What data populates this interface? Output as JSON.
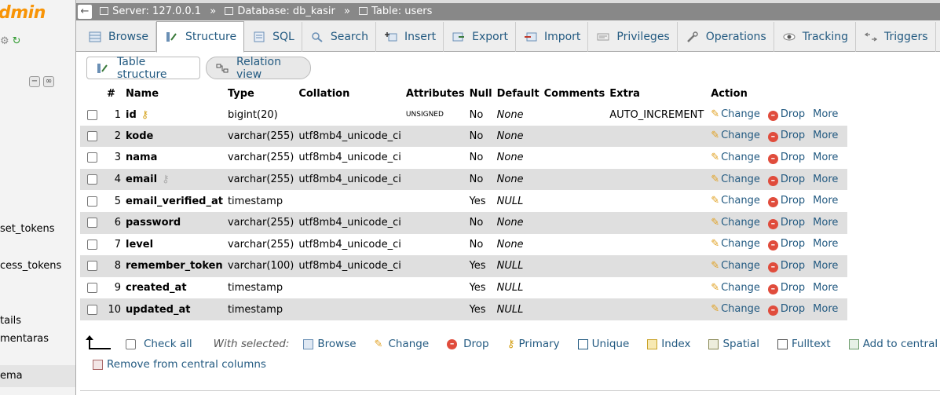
{
  "left_nav": {
    "brand": "dmin",
    "items": [
      {
        "label": "set_tokens",
        "highlight": false
      },
      {
        "label": "cess_tokens",
        "highlight": false
      },
      {
        "label": "tails",
        "highlight": false
      },
      {
        "label": "mentaras",
        "highlight": false
      },
      {
        "label": "ema",
        "highlight": true
      }
    ]
  },
  "breadcrumb": {
    "server": "Server: 127.0.0.1",
    "database": "Database: db_kasir",
    "table": "Table: users",
    "separator": "»"
  },
  "tabs": [
    {
      "label": "Browse",
      "icon": "browse-icon",
      "active": false
    },
    {
      "label": "Structure",
      "icon": "structure-icon",
      "active": true
    },
    {
      "label": "SQL",
      "icon": "sql-icon",
      "active": false
    },
    {
      "label": "Search",
      "icon": "search-icon",
      "active": false
    },
    {
      "label": "Insert",
      "icon": "insert-icon",
      "active": false
    },
    {
      "label": "Export",
      "icon": "export-icon",
      "active": false
    },
    {
      "label": "Import",
      "icon": "import-icon",
      "active": false
    },
    {
      "label": "Privileges",
      "icon": "privileges-icon",
      "active": false
    },
    {
      "label": "Operations",
      "icon": "wrench-icon",
      "active": false
    },
    {
      "label": "Tracking",
      "icon": "eye-icon",
      "active": false
    },
    {
      "label": "Triggers",
      "icon": "triggers-icon",
      "active": false
    }
  ],
  "subtabs": {
    "table_structure": "Table structure",
    "relation_view": "Relation view"
  },
  "columns": [
    "#",
    "Name",
    "Type",
    "Collation",
    "Attributes",
    "Null",
    "Default",
    "Comments",
    "Extra",
    "Action"
  ],
  "rows": [
    {
      "num": "1",
      "name": "id",
      "key": "primary",
      "type": "bigint(20)",
      "collation": "",
      "attributes": "UNSIGNED",
      "null": "No",
      "default": "None",
      "comments": "",
      "extra": "AUTO_INCREMENT"
    },
    {
      "num": "2",
      "name": "kode",
      "key": "",
      "type": "varchar(255)",
      "collation": "utf8mb4_unicode_ci",
      "attributes": "",
      "null": "No",
      "default": "None",
      "comments": "",
      "extra": ""
    },
    {
      "num": "3",
      "name": "nama",
      "key": "",
      "type": "varchar(255)",
      "collation": "utf8mb4_unicode_ci",
      "attributes": "",
      "null": "No",
      "default": "None",
      "comments": "",
      "extra": ""
    },
    {
      "num": "4",
      "name": "email",
      "key": "index",
      "type": "varchar(255)",
      "collation": "utf8mb4_unicode_ci",
      "attributes": "",
      "null": "No",
      "default": "None",
      "comments": "",
      "extra": ""
    },
    {
      "num": "5",
      "name": "email_verified_at",
      "key": "",
      "type": "timestamp",
      "collation": "",
      "attributes": "",
      "null": "Yes",
      "default": "NULL",
      "comments": "",
      "extra": ""
    },
    {
      "num": "6",
      "name": "password",
      "key": "",
      "type": "varchar(255)",
      "collation": "utf8mb4_unicode_ci",
      "attributes": "",
      "null": "No",
      "default": "None",
      "comments": "",
      "extra": ""
    },
    {
      "num": "7",
      "name": "level",
      "key": "",
      "type": "varchar(255)",
      "collation": "utf8mb4_unicode_ci",
      "attributes": "",
      "null": "No",
      "default": "None",
      "comments": "",
      "extra": ""
    },
    {
      "num": "8",
      "name": "remember_token",
      "key": "",
      "type": "varchar(100)",
      "collation": "utf8mb4_unicode_ci",
      "attributes": "",
      "null": "Yes",
      "default": "NULL",
      "comments": "",
      "extra": ""
    },
    {
      "num": "9",
      "name": "created_at",
      "key": "",
      "type": "timestamp",
      "collation": "",
      "attributes": "",
      "null": "Yes",
      "default": "NULL",
      "comments": "",
      "extra": ""
    },
    {
      "num": "10",
      "name": "updated_at",
      "key": "",
      "type": "timestamp",
      "collation": "",
      "attributes": "",
      "null": "Yes",
      "default": "NULL",
      "comments": "",
      "extra": ""
    }
  ],
  "row_actions": {
    "change": "Change",
    "drop": "Drop",
    "more": "More"
  },
  "footer": {
    "check_all": "Check all",
    "with_selected": "With selected:",
    "actions": [
      {
        "label": "Browse",
        "icon": "browse-icon"
      },
      {
        "label": "Change",
        "icon": "pencil-icon"
      },
      {
        "label": "Drop",
        "icon": "drop-icon"
      },
      {
        "label": "Primary",
        "icon": "key-icon"
      },
      {
        "label": "Unique",
        "icon": "unique-icon"
      },
      {
        "label": "Index",
        "icon": "index-icon"
      },
      {
        "label": "Spatial",
        "icon": "spatial-icon"
      },
      {
        "label": "Fulltext",
        "icon": "fulltext-icon"
      },
      {
        "label": "Add to central",
        "icon": "central-columns-icon"
      }
    ],
    "remove_central": "Remove from central columns"
  }
}
